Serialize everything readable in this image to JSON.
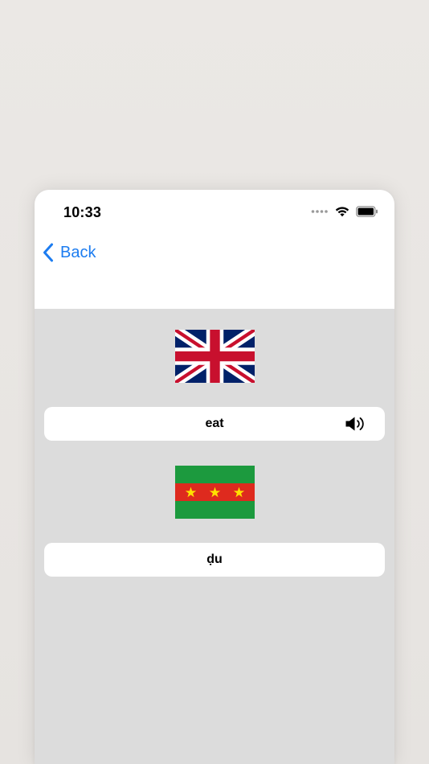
{
  "status_bar": {
    "time": "10:33",
    "icons": [
      "cellular-dots-icon",
      "wifi-icon",
      "battery-icon"
    ]
  },
  "nav": {
    "back_label": "Back"
  },
  "cards": {
    "source": {
      "flag": "uk-flag-icon",
      "word": "eat",
      "audio_icon": "speaker-icon"
    },
    "target": {
      "flag": "green-red-three-star-flag-icon",
      "word": "ḍu"
    }
  },
  "colors": {
    "accent": "#1c7cf0",
    "background": "#dcdcdc",
    "card": "#ffffff"
  }
}
